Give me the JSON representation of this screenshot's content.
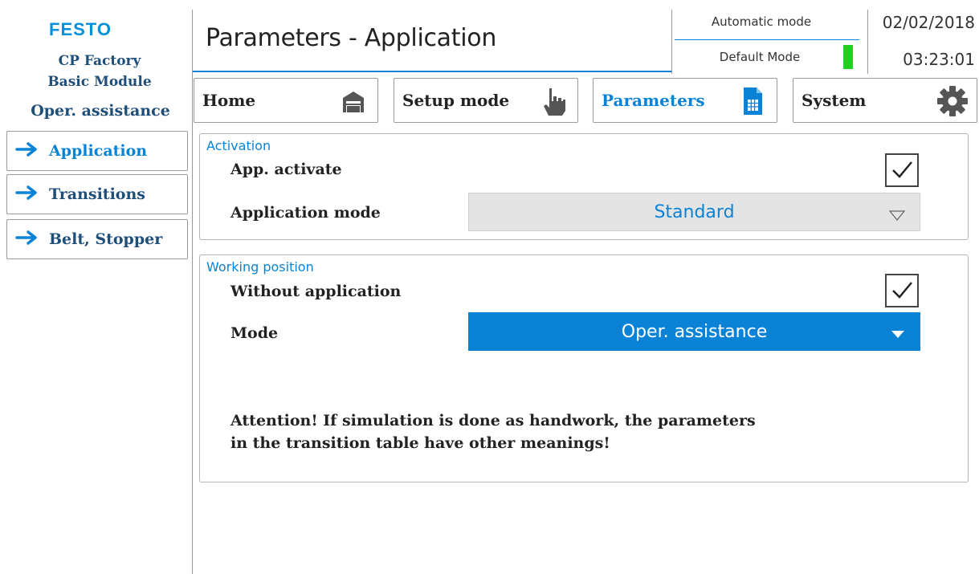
{
  "brand": {
    "logo": "FESTO",
    "line1": "CP Factory",
    "line2": "Basic Module",
    "line3": "Oper. assistance"
  },
  "sidebar": {
    "items": [
      {
        "label": "Application",
        "active": true
      },
      {
        "label": "Transitions",
        "active": false
      },
      {
        "label": "Belt, Stopper",
        "active": false
      }
    ]
  },
  "header": {
    "title": "Parameters - Application",
    "operating_mode": "Automatic mode",
    "sub_mode": "Default Mode",
    "date": "02/02/2018",
    "time": "03:23:01"
  },
  "tabs": [
    {
      "label": "Home",
      "icon": "garage-icon",
      "active": false
    },
    {
      "label": "Setup mode",
      "icon": "hand-pointer-icon",
      "active": false
    },
    {
      "label": "Parameters",
      "icon": "document-table-icon",
      "active": true
    },
    {
      "label": "System",
      "icon": "gear-icon",
      "active": false
    }
  ],
  "activation": {
    "title": "Activation",
    "app_activate_label": "App. activate",
    "app_activate_checked": true,
    "application_mode_label": "Application mode",
    "application_mode_value": "Standard"
  },
  "working_position": {
    "title": "Working position",
    "without_application_label": "Without application",
    "without_application_checked": true,
    "mode_label": "Mode",
    "mode_value": "Oper. assistance",
    "attention_line1": "Attention! If simulation is done as handwork, the parameters",
    "attention_line2": "in the transition table have other meanings!"
  },
  "colors": {
    "accent": "#0a83d6",
    "brand_text": "#1f4e79",
    "status_led": "#22d022"
  }
}
